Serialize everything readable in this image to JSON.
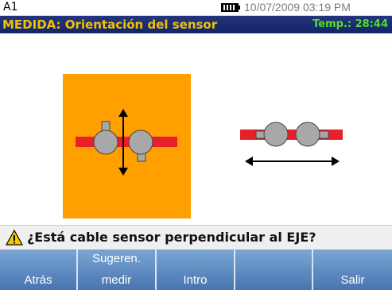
{
  "status": {
    "channel_id": "A1",
    "datetime": "10/07/2009 03:19 PM",
    "battery_icon": "battery-full-icon"
  },
  "header": {
    "title": "MEDIDA: Orientación del sensor",
    "temperature": "Temp.: 28:44"
  },
  "illustration": {
    "highlight_color": "#ff9f00",
    "cable_color": "#e8202a",
    "sensor_color": "#a8a8a8",
    "option_left": "sensor-vertical-orientation",
    "option_right": "sensor-horizontal-orientation"
  },
  "prompt": {
    "icon": "warning-icon",
    "question": "¿Está cable sensor perpendicular al EJE?"
  },
  "softkeys": [
    {
      "line1": "",
      "line2": "Atrás"
    },
    {
      "line1": "Sugeren.",
      "line2": "medir"
    },
    {
      "line1": "",
      "line2": "Intro"
    },
    {
      "line1": "",
      "line2": ""
    },
    {
      "line1": "",
      "line2": "Salir"
    }
  ],
  "colors": {
    "title_bg": "#1c2e74",
    "title_text": "#f2c200",
    "temp_text": "#54dc2a",
    "softkey_bg": "#5f8cc4"
  }
}
